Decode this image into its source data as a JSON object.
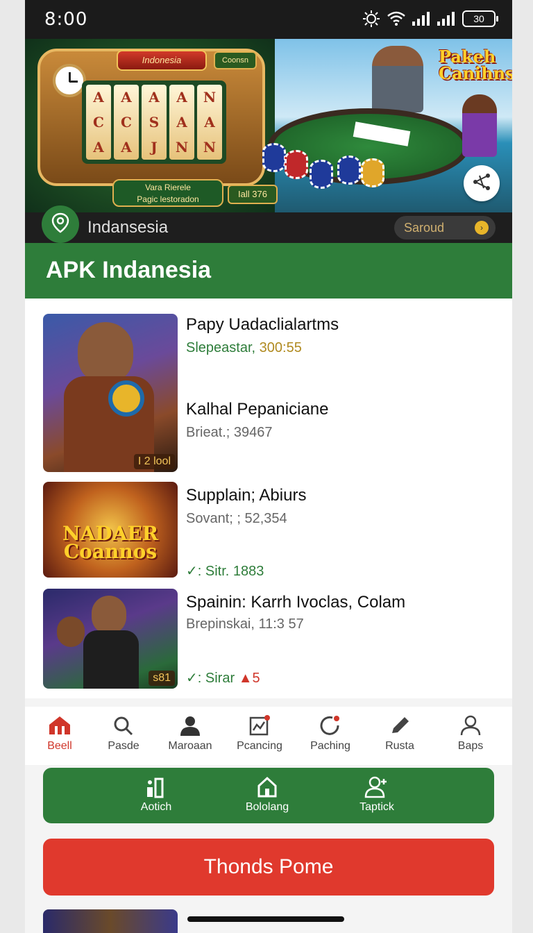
{
  "status_bar": {
    "time": "8:00",
    "battery": "30"
  },
  "hero": {
    "slot_title": "Indonesia",
    "slot_tag": "Coonsn",
    "slot_sub_line1": "Vara Rierele",
    "slot_sub_line2": "Pagic lestoradon",
    "slot_count": "Iall 376",
    "reel_symbols": [
      [
        "A",
        "C",
        "A"
      ],
      [
        "A",
        "C",
        "A"
      ],
      [
        "A",
        "S",
        "J"
      ],
      [
        "A",
        "A",
        "N"
      ],
      [
        "N",
        "A",
        "N"
      ]
    ],
    "logo_line1": "Pakeh",
    "logo_line2": "Canihns"
  },
  "location": {
    "name": "Indansesia",
    "pill": "Saroud",
    "pill_icon": "arrow-icon"
  },
  "page_title": "APK Indanesia",
  "items": [
    {
      "title": "Papy Uadaclialartms",
      "sub1": "Slepeastar,",
      "sub2": "300:55",
      "badge": "I 2 lool"
    },
    {
      "title": "Kalhal Pepaniciane",
      "sub1": "Brieat.; 39467"
    },
    {
      "title": "Supplain; Abiurs",
      "sub1": "Sovant; ; 52,354",
      "sub2": "Sitr. 1883",
      "thumb_text_1": "NADAER",
      "thumb_text_2": "Coannos"
    },
    {
      "title": "Spainin: Karrh Ivoclas, Colam",
      "sub1": "Brepinskai, 11:3 57",
      "sub2": "Sirar",
      "sub3": "5",
      "badge": "s81"
    }
  ],
  "nav": [
    {
      "label": "Beell",
      "icon": "home-icon"
    },
    {
      "label": "Pasde",
      "icon": "search-icon"
    },
    {
      "label": "Maroaan",
      "icon": "user-icon"
    },
    {
      "label": "Pcancing",
      "icon": "chart-icon"
    },
    {
      "label": "Paching",
      "icon": "refresh-icon"
    },
    {
      "label": "Rusta",
      "icon": "pen-icon"
    },
    {
      "label": "Baps",
      "icon": "profile-icon"
    }
  ],
  "actions": [
    {
      "label": "Aotich",
      "icon": "apps-icon"
    },
    {
      "label": "Bololang",
      "icon": "house-icon"
    },
    {
      "label": "Taptick",
      "icon": "add-user-icon"
    }
  ],
  "cta": "Thonds Pome",
  "colors": {
    "green": "#2e7d3a",
    "red": "#e0392d",
    "active_nav": "#d0362a"
  }
}
